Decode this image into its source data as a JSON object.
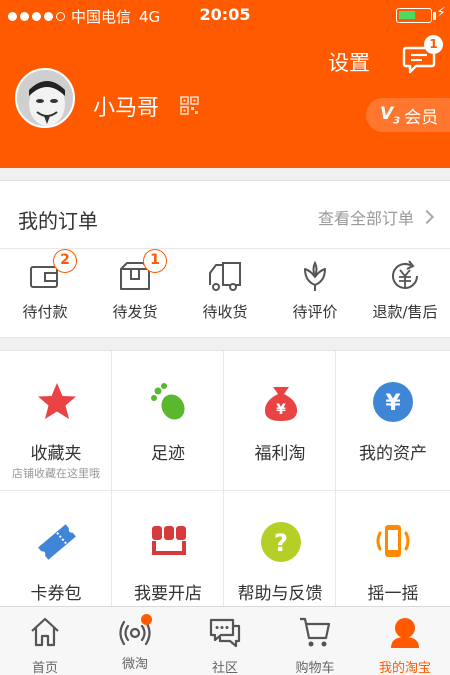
{
  "status_bar": {
    "carrier": "中国电信",
    "network": "4G",
    "time": "20:05",
    "battery_level": 0.55
  },
  "header": {
    "settings_label": "设置",
    "message_count": "1",
    "username": "小马哥",
    "vip_label": "会员",
    "vip_level": "V",
    "vip_level_num": "3"
  },
  "orders": {
    "title": "我的订单",
    "view_all": "查看全部订单",
    "items": [
      {
        "label": "待付款",
        "badge": "2",
        "icon": "wallet-icon"
      },
      {
        "label": "待发货",
        "badge": "1",
        "icon": "package-icon"
      },
      {
        "label": "待收货",
        "badge": "",
        "icon": "truck-icon"
      },
      {
        "label": "待评价",
        "badge": "",
        "icon": "lotus-icon"
      },
      {
        "label": "退款/售后",
        "badge": "",
        "icon": "refund-icon"
      }
    ]
  },
  "services": [
    {
      "label": "收藏夹",
      "sub": "店铺收藏在这里哦",
      "icon": "star-icon"
    },
    {
      "label": "足迹",
      "sub": "",
      "icon": "footprint-icon"
    },
    {
      "label": "福利淘",
      "sub": "",
      "icon": "money-bag-icon"
    },
    {
      "label": "我的资产",
      "sub": "",
      "icon": "yuan-coin-icon"
    },
    {
      "label": "卡券包",
      "sub": "",
      "icon": "ticket-icon"
    },
    {
      "label": "我要开店",
      "sub": "",
      "icon": "shop-icon"
    },
    {
      "label": "帮助与反馈",
      "sub": "",
      "icon": "help-icon"
    },
    {
      "label": "摇一摇",
      "sub": "",
      "icon": "shake-phone-icon"
    }
  ],
  "tabs": [
    {
      "label": "首页",
      "icon": "home-icon"
    },
    {
      "label": "微淘",
      "icon": "broadcast-icon"
    },
    {
      "label": "社区",
      "icon": "chat-icon"
    },
    {
      "label": "购物车",
      "icon": "cart-icon"
    },
    {
      "label": "我的淘宝",
      "icon": "person-icon"
    }
  ],
  "colors": {
    "brand": "#ff5a00",
    "star": "#e94343",
    "green": "#5ab82e",
    "blue": "#3f86d6",
    "yellow_green": "#b6cf27",
    "orange": "#ff8a00"
  }
}
